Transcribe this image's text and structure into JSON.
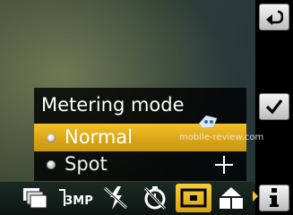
{
  "menu": {
    "title": "Metering mode",
    "items": [
      {
        "label": "Normal",
        "selected": true
      },
      {
        "label": "Spot",
        "selected": false
      }
    ]
  },
  "watermark": {
    "text": "mobile-review.com"
  },
  "sidebar": {
    "buttons": [
      {
        "icon": "back-arrow-icon"
      },
      {
        "icon": "checkmark-icon"
      },
      {
        "icon": "info-icon"
      }
    ]
  },
  "toolbar": {
    "resolution_label": "3MP",
    "items": [
      {
        "icon": "shooting-mode-icon"
      },
      {
        "icon": "resolution-icon"
      },
      {
        "icon": "flash-off-icon"
      },
      {
        "icon": "self-timer-off-icon"
      },
      {
        "icon": "metering-mode-icon",
        "active": true
      },
      {
        "icon": "scene-mode-icon"
      }
    ]
  },
  "colors": {
    "accent": "#f3c12a",
    "menu_bg": "#000000",
    "toolbar_bg": "#0d1512"
  }
}
